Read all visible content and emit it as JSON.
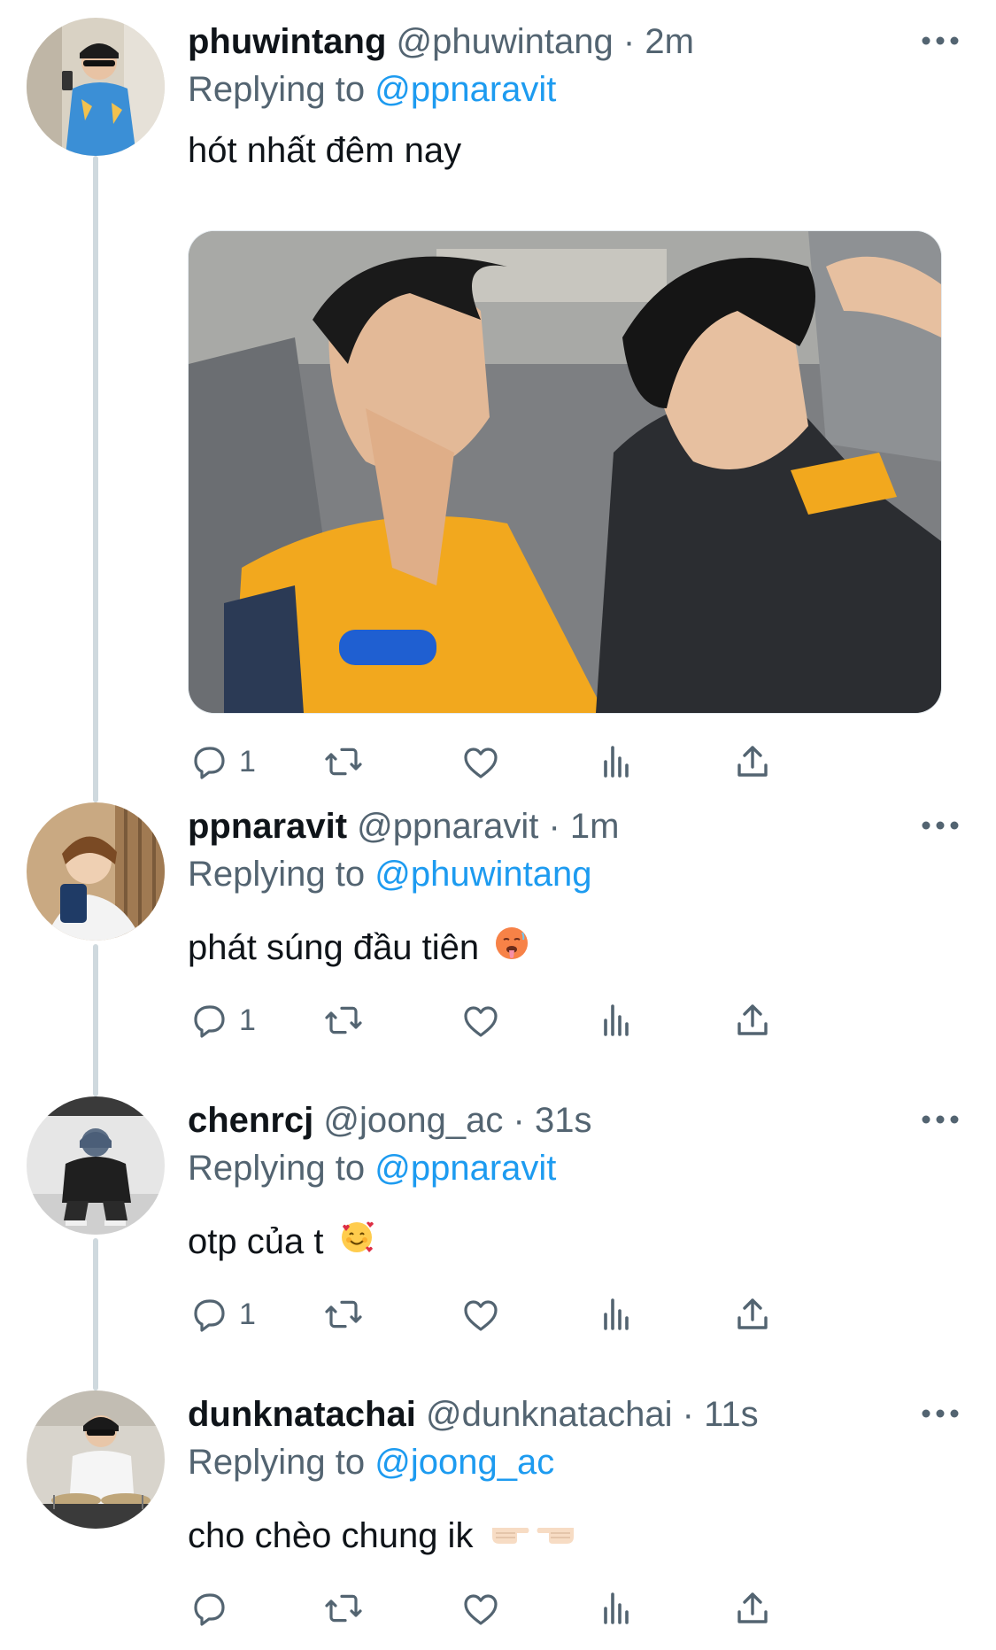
{
  "colors": {
    "link": "#1d9bf0",
    "secondary_text": "#536471",
    "primary_text": "#0f1419",
    "thread_line": "#cfd9de"
  },
  "icons": {
    "reply": "reply-icon",
    "retweet": "retweet-icon",
    "like": "like-icon",
    "views": "views-icon",
    "share": "share-icon",
    "more": "more-icon"
  },
  "replying_label": "Replying to",
  "tweets": [
    {
      "display_name": "phuwintang",
      "handle": "@phuwintang",
      "separator": "·",
      "time": "2m",
      "replying_to": "@ppnaravit",
      "text": "hót nhất đêm nay",
      "reply_count": "1",
      "has_media": true
    },
    {
      "display_name": "ppnaravit",
      "handle": "@ppnaravit",
      "separator": "·",
      "time": "1m",
      "replying_to": "@phuwintang",
      "text": "phát súng đầu tiên",
      "emoji": "hot-face-emoji",
      "reply_count": "1"
    },
    {
      "display_name": "chenrcj",
      "handle": "@joong_ac",
      "separator": "·",
      "time": "31s",
      "replying_to": "@ppnaravit",
      "text": "otp của t",
      "emoji": "smiling-face-with-hearts-emoji",
      "reply_count": "1"
    },
    {
      "display_name": "dunknatachai",
      "handle": "@dunknatachai",
      "separator": "·",
      "time": "11s",
      "replying_to": "@joong_ac",
      "text": "cho chèo chung ik",
      "emoji": "pointing-hands-emoji",
      "reply_count": ""
    }
  ]
}
